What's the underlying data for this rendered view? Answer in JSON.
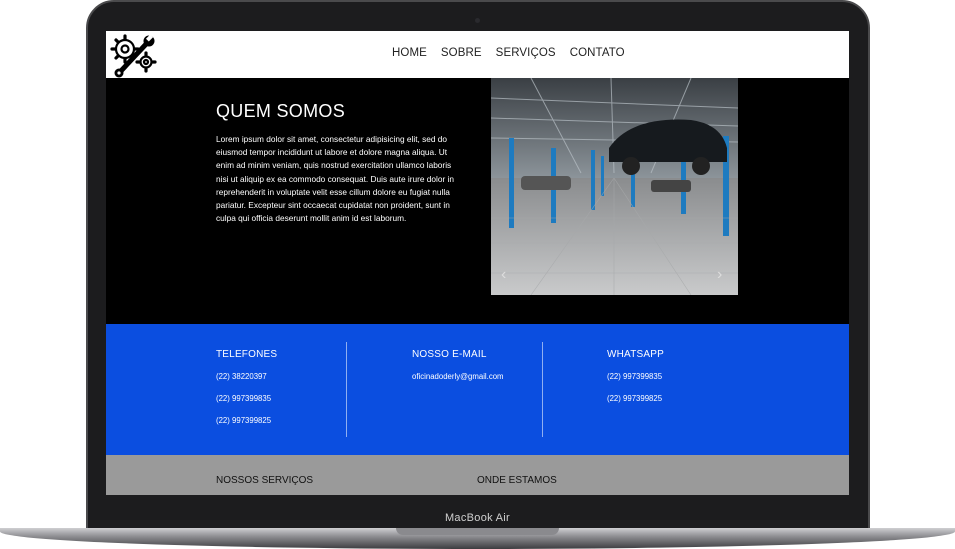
{
  "device": {
    "label": "MacBook Air"
  },
  "navbar": {
    "logo_icon": "gear-wrench-icon",
    "items": [
      {
        "label": "HOME"
      },
      {
        "label": "SOBRE"
      },
      {
        "label": "SERVIÇOS"
      },
      {
        "label": "CONTATO"
      }
    ]
  },
  "about": {
    "title": "QUEM SOMOS",
    "text": "Lorem ipsum dolor sit amet, consectetur adipisicing elit, sed do eiusmod tempor incididunt ut labore et dolore magna aliqua. Ut enim ad minim veniam, quis nostrud exercitation ullamco laboris nisi ut aliquip ex ea commodo consequat. Duis aute irure dolor in reprehenderit in voluptate velit esse cillum dolore eu fugiat nulla pariatur. Excepteur sint occaecat cupidatat non proident, sunt in culpa qui officia deserunt mollit anim id est laborum."
  },
  "carousel": {
    "prev_icon": "chevron-left-icon",
    "next_icon": "chevron-right-icon",
    "prev": "‹",
    "next": "›"
  },
  "contacts": {
    "telefones": {
      "title": "TELEFONES",
      "items": [
        "(22) 38220397",
        "(22) 997399835",
        "(22) 997399825"
      ]
    },
    "email": {
      "title": "NOSSO E-MAIL",
      "items": [
        "oficinadoderly@gmail.com"
      ]
    },
    "whatsapp": {
      "title": "WHATSAPP",
      "items": [
        "(22) 997399835",
        "(22) 997399825"
      ]
    }
  },
  "footer": {
    "services": "NOSSOS SERVIÇOS",
    "location": "ONDE ESTAMOS"
  },
  "colors": {
    "contact_bg": "#0b4ee0",
    "footer_bg": "#9a9a9a",
    "screen_bg": "#000000"
  }
}
